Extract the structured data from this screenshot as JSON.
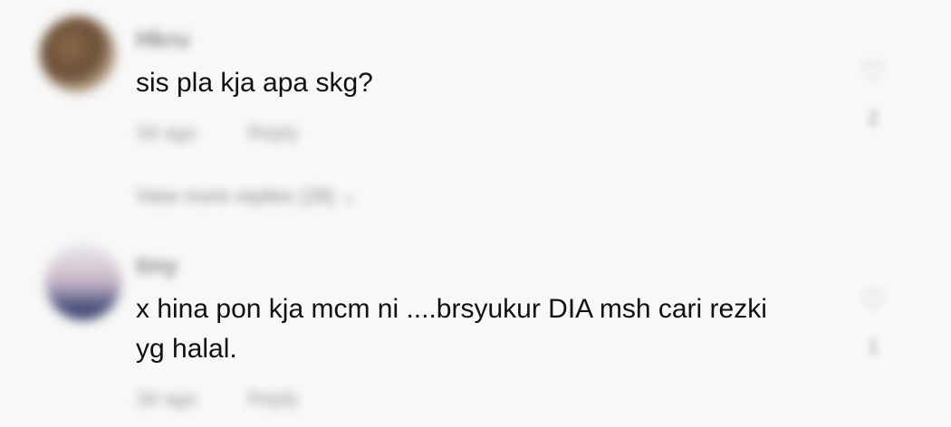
{
  "comments": [
    {
      "username": "Hkru",
      "text_lines": [
        "sis pla kja apa skg?"
      ],
      "time": "3d ago",
      "reply_label": "Reply",
      "view_replies": "View more replies (28)",
      "like_icon": "heart-icon",
      "like_count": "2"
    },
    {
      "username": "tiny",
      "text_lines": [
        "x hina pon kja mcm ni ....brsyukur DIA msh cari rezki",
        "yg halal."
      ],
      "time": "3d ago",
      "reply_label": "Reply",
      "like_icon": "heart-icon",
      "like_count": "1"
    }
  ]
}
